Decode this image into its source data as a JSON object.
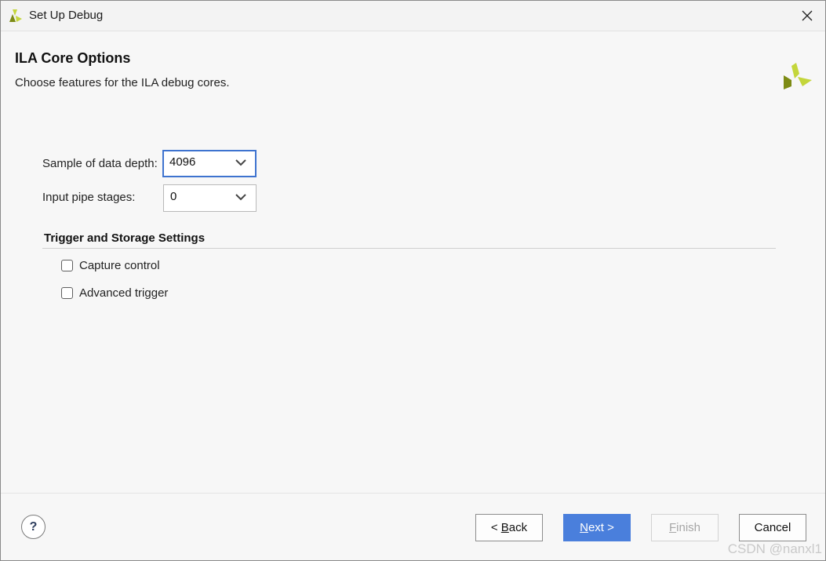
{
  "window": {
    "title": "Set Up Debug",
    "close_icon": "close-icon",
    "app_icon": "vivado-logo-icon"
  },
  "header": {
    "title": "ILA Core Options",
    "subtitle": "Choose features for the ILA debug cores."
  },
  "fields": {
    "sample_depth": {
      "label": "Sample of data depth:",
      "value": "4096"
    },
    "pipe_stages": {
      "label": "Input pipe stages:",
      "value": "0"
    }
  },
  "trigger_section": {
    "title": "Trigger and Storage Settings",
    "capture_control": {
      "label": "Capture control",
      "checked": false
    },
    "advanced_trigger": {
      "label": "Advanced trigger",
      "checked": false
    }
  },
  "footer": {
    "help": "?",
    "back_prefix": "< ",
    "back_mnemonic": "B",
    "back_rest": "ack",
    "next_mnemonic": "N",
    "next_rest": "ext >",
    "finish_mnemonic": "F",
    "finish_rest": "inish",
    "cancel": "Cancel"
  },
  "watermark": "CSDN @nanxl1",
  "colors": {
    "accent": "#4a7fdc",
    "brand_green_light": "#c4d63b",
    "brand_green_dark": "#7d8b14"
  }
}
